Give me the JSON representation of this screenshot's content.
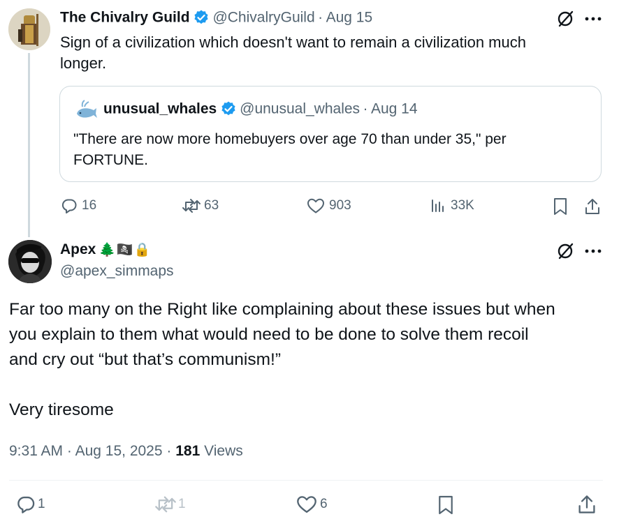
{
  "parent_tweet": {
    "display_name": "The Chivalry Guild",
    "handle": "@ChivalryGuild",
    "date": "Aug 15",
    "text_line1": "Sign of a civilization which doesn't want to remain a civilization much",
    "text_line2": "longer.",
    "quote": {
      "display_name": "unusual_whales",
      "handle": "@unusual_whales",
      "date": "Aug 14",
      "text_line1": "\"There are now more homebuyers over age 70 than under 35,\" per",
      "text_line2": "FORTUNE."
    },
    "actions": {
      "replies": "16",
      "reposts": "63",
      "likes": "903",
      "views": "33K"
    }
  },
  "main_tweet": {
    "display_name": "Apex",
    "name_emojis": "🌲 🏴‍☠️ 🔒",
    "handle": "@apex_simmaps",
    "text_line1": "Far too many on the Right like complaining about these issues but when",
    "text_line2": "you explain to them what would need to be done to solve them recoil",
    "text_line3": "and cry out “but that’s communism!”",
    "text_line4": "Very tiresome",
    "time": "9:31 AM",
    "full_date": "Aug 15, 2025",
    "view_count": "181",
    "views_label": "Views",
    "actions": {
      "replies": "1",
      "reposts": "1",
      "likes": "6"
    }
  },
  "colors": {
    "verified_blue": "#1d9bf0",
    "muted_text": "#536471",
    "thread_line": "#cfd9de",
    "border": "#cfd9de"
  },
  "icons": [
    "grok-icon",
    "more-icon",
    "reply-icon",
    "repost-icon",
    "like-icon",
    "views-icon",
    "bookmark-icon",
    "share-icon",
    "verified-badge-icon",
    "lock-icon"
  ]
}
